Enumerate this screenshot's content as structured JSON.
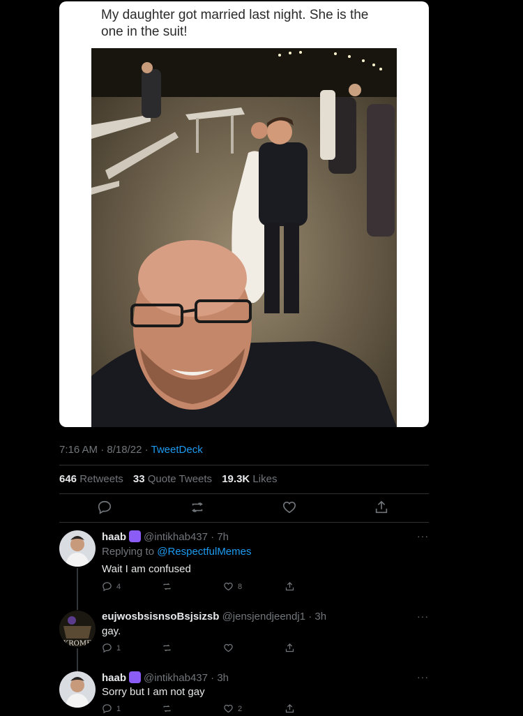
{
  "tweet": {
    "caption": "My daughter got married last night. She is the one in the suit!",
    "time": "7:16 AM",
    "date": "8/18/22",
    "source": "TweetDeck",
    "retweets": "646",
    "retweets_label": "Retweets",
    "quote_tweets": "33",
    "quote_tweets_label": "Quote Tweets",
    "likes": "19.3K",
    "likes_label": "Likes"
  },
  "replies": [
    {
      "name": "haab",
      "handle": "@intikhab437",
      "time": "7h",
      "replying_label": "Replying to",
      "replying_to": "@RespectfulMemes",
      "text": "Wait I am confused",
      "reply_count": "4",
      "retweet_count": "",
      "like_count": "8"
    },
    {
      "name": "eujwosbsisnsoBsjsizsb",
      "handle": "@jensjendjeendj1",
      "time": "3h",
      "text": "gay.",
      "avatar_text": "KROME",
      "reply_count": "1",
      "retweet_count": "",
      "like_count": ""
    },
    {
      "name": "haab",
      "handle": "@intikhab437",
      "time": "3h",
      "text": "Sorry but I am not gay",
      "reply_count": "1",
      "retweet_count": "",
      "like_count": "2"
    }
  ],
  "colors": {
    "background": "#000000",
    "link": "#1d9bf0",
    "muted": "#71767b",
    "badge": "#8b5cf6"
  }
}
